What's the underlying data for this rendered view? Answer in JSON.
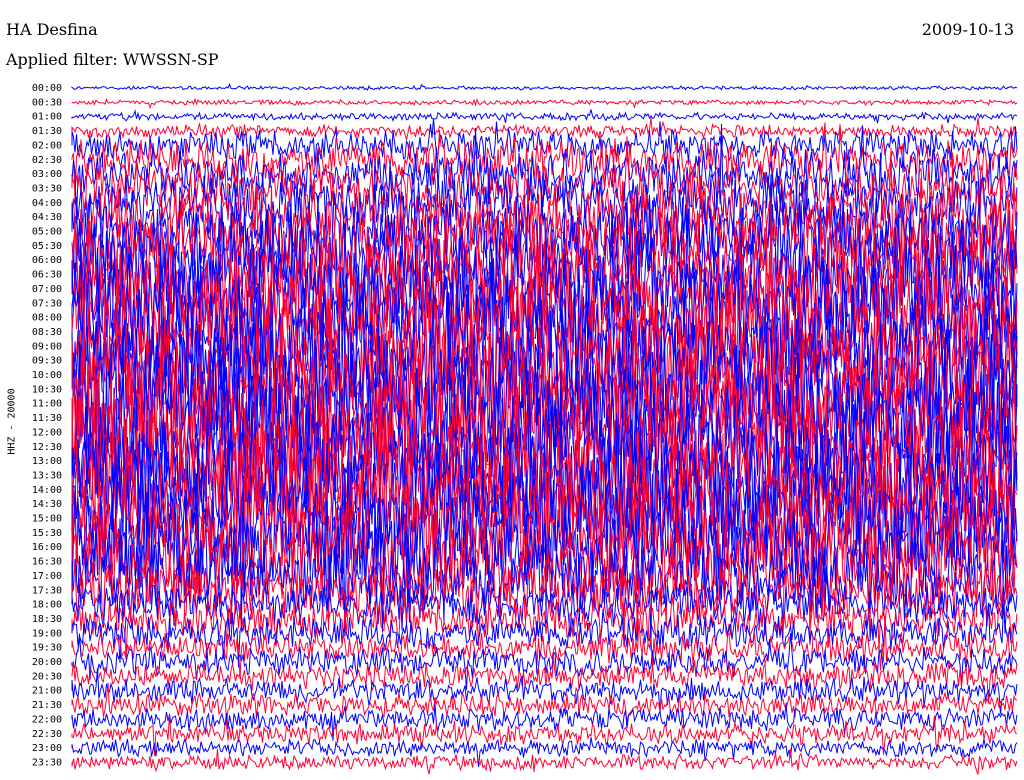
{
  "header": {
    "station": "HA Desfina",
    "filter": "Applied filter: WWSSN-SP",
    "date": "2009-10-13"
  },
  "chart_data": {
    "type": "helicorder",
    "channel_label": "HHZ - 20000",
    "colors": {
      "line_even": "#0000ff",
      "line_odd": "#ff0033",
      "background": "#ffffff",
      "text": "#000000"
    },
    "row_labels": [
      "00:00",
      "00:30",
      "01:00",
      "01:30",
      "02:00",
      "02:30",
      "03:00",
      "03:30",
      "04:00",
      "04:30",
      "05:00",
      "05:30",
      "06:00",
      "06:30",
      "07:00",
      "07:30",
      "08:00",
      "08:30",
      "09:00",
      "09:30",
      "10:00",
      "10:30",
      "11:00",
      "11:30",
      "12:00",
      "12:30",
      "13:00",
      "13:30",
      "14:00",
      "14:30",
      "15:00",
      "15:30",
      "16:00",
      "16:30",
      "17:00",
      "17:30",
      "18:00",
      "18:30",
      "19:00",
      "19:30",
      "20:00",
      "20:30",
      "21:00",
      "21:30",
      "22:00",
      "22:30",
      "23:00",
      "23:30"
    ],
    "row_amplitude": [
      0.15,
      0.2,
      0.3,
      0.5,
      1.2,
      1.6,
      1.9,
      2.0,
      2.2,
      2.8,
      3.0,
      3.5,
      3.8,
      4.0,
      4.0,
      4.2,
      4.5,
      4.6,
      4.6,
      4.8,
      4.8,
      4.9,
      5.0,
      5.0,
      5.0,
      5.0,
      5.0,
      5.0,
      4.8,
      4.8,
      4.6,
      4.4,
      4.0,
      3.6,
      3.0,
      2.4,
      1.8,
      1.6,
      1.3,
      1.2,
      1.1,
      1.0,
      1.0,
      0.9,
      0.9,
      0.8,
      0.7,
      0.6
    ]
  }
}
